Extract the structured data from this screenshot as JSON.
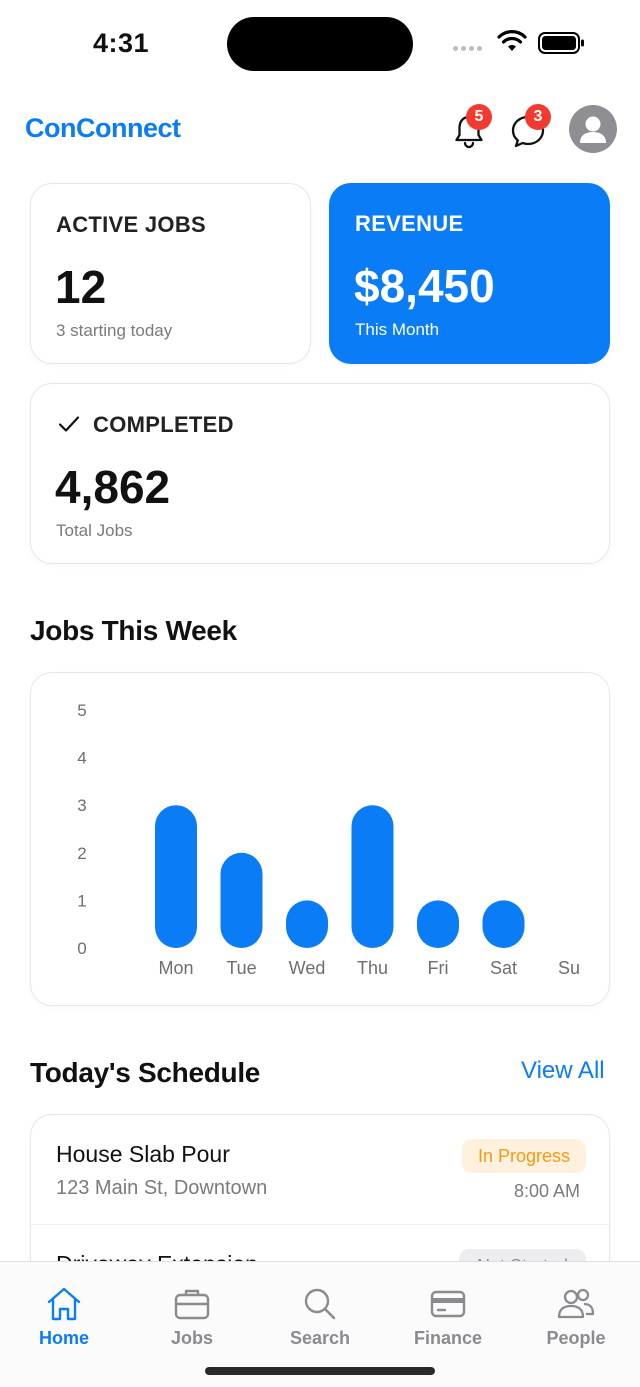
{
  "status_bar": {
    "time": "4:31"
  },
  "header": {
    "app_title": "ConConnect",
    "notifications_count": "5",
    "messages_count": "3"
  },
  "cards": {
    "active_jobs": {
      "label": "ACTIVE JOBS",
      "value": "12",
      "sub": "3 starting today"
    },
    "revenue": {
      "label": "REVENUE",
      "value": "$8,450",
      "sub": "This Month"
    },
    "completed": {
      "label": "COMPLETED",
      "value": "4,862",
      "sub": "Total Jobs"
    }
  },
  "chart_section": {
    "title": "Jobs This Week"
  },
  "chart_data": {
    "type": "bar",
    "categories": [
      "Mon",
      "Tue",
      "Wed",
      "Thu",
      "Fri",
      "Sat",
      "Su"
    ],
    "values": [
      3,
      2,
      1,
      3,
      1,
      1,
      0
    ],
    "ylim": [
      0,
      5
    ],
    "yticks": [
      "0",
      "1",
      "2",
      "3",
      "4",
      "5"
    ],
    "bar_color": "#0A7CF6",
    "grid": false
  },
  "schedule": {
    "title": "Today's Schedule",
    "view_all": "View All",
    "items": [
      {
        "title": "House Slab Pour",
        "address": "123 Main St, Downtown",
        "status": "In Progress",
        "time": "8:00 AM"
      },
      {
        "title": "Driveway Extension",
        "status": "Not Started"
      }
    ]
  },
  "tabs": [
    {
      "label": "Home",
      "icon": "home-icon",
      "active": true
    },
    {
      "label": "Jobs",
      "icon": "briefcase-icon",
      "active": false
    },
    {
      "label": "Search",
      "icon": "search-icon",
      "active": false
    },
    {
      "label": "Finance",
      "icon": "credit-card-icon",
      "active": false
    },
    {
      "label": "People",
      "icon": "people-icon",
      "active": false
    }
  ],
  "colors": {
    "accent": "#0A7CF6",
    "badge": "#F23B30",
    "in_progress_text": "#F49A10",
    "in_progress_bg": "#FFF1DE"
  }
}
